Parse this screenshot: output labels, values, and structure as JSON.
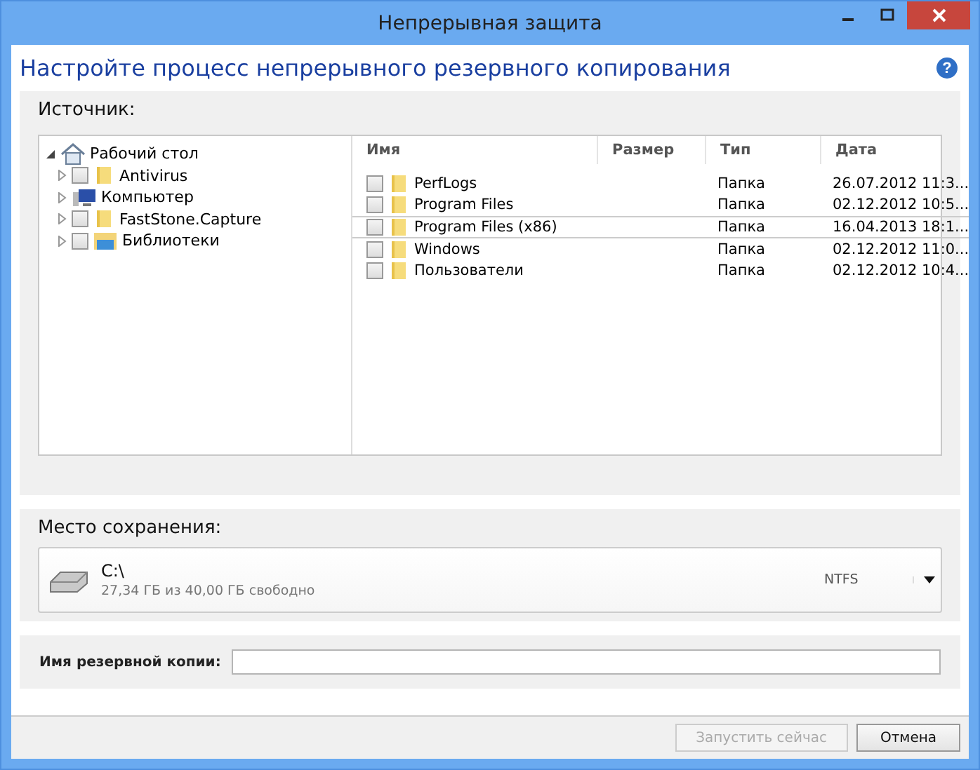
{
  "window": {
    "title": "Непрерывная защита"
  },
  "heading": "Настройте процесс непрерывного резервного копирования",
  "help": "?",
  "source": {
    "label": "Источник:",
    "tree": [
      {
        "label": "Рабочий стол",
        "kind": "desktop",
        "expanded": true,
        "children": [
          {
            "label": "Antivirus",
            "kind": "folder",
            "expanded": false,
            "checked": false
          },
          {
            "label": "Компьютер",
            "kind": "computer",
            "expanded": false
          },
          {
            "label": "FastStone.Capture",
            "kind": "folder",
            "expanded": false,
            "checked": false
          },
          {
            "label": "Библиотеки",
            "kind": "library",
            "expanded": false,
            "checked": false
          }
        ]
      }
    ],
    "columns": [
      "Имя",
      "Размер",
      "Тип",
      "Дата"
    ],
    "rows": [
      {
        "name": "PerfLogs",
        "type": "Папка",
        "date": "26.07.2012 11:3...",
        "checked": false,
        "selected": false
      },
      {
        "name": "Program Files",
        "type": "Папка",
        "date": "02.12.2012 10:5...",
        "checked": false,
        "selected": false
      },
      {
        "name": "Program Files (x86)",
        "type": "Папка",
        "date": "16.04.2013 18:1...",
        "checked": false,
        "selected": true
      },
      {
        "name": "Windows",
        "type": "Папка",
        "date": "02.12.2012 11:0...",
        "checked": false,
        "selected": false
      },
      {
        "name": "Пользователи",
        "type": "Папка",
        "date": "02.12.2012 10:4...",
        "checked": false,
        "selected": false
      }
    ]
  },
  "destination": {
    "label": "Место сохранения:",
    "drive": "C:\\",
    "free": "27,34 ГБ из 40,00 ГБ свободно",
    "filesystem": "NTFS"
  },
  "backup_name": {
    "label": "Имя резервной копии:"
  },
  "buttons": [
    {
      "label": "Запустить сейчас",
      "disabled": true
    },
    {
      "label": "Отмена",
      "disabled": false
    }
  ]
}
